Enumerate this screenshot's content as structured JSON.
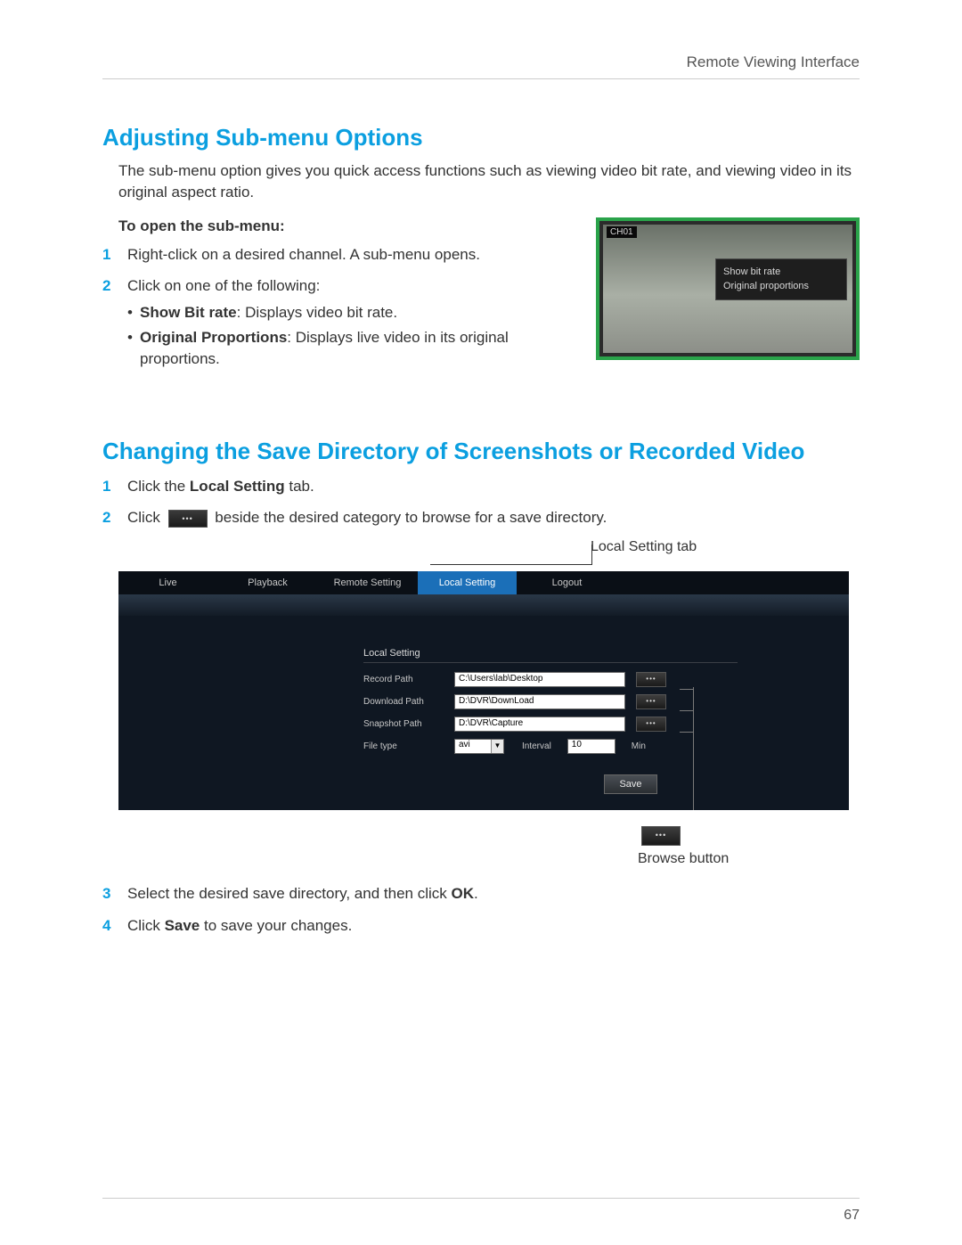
{
  "header": {
    "right": "Remote Viewing Interface"
  },
  "section1": {
    "title": "Adjusting Sub-menu Options",
    "intro": "The sub-menu option gives you quick access functions such as viewing video bit rate, and viewing video in its original aspect ratio.",
    "sub": "To open the sub-menu:",
    "steps": {
      "s1": "Right-click on a desired channel. A sub-menu opens.",
      "s2": "Click on one of the following:",
      "b1_bold": "Show Bit rate",
      "b1_rest": ": Displays video bit rate.",
      "b2_bold": "Original Proportions",
      "b2_rest": ": Displays live video in its original proportions."
    },
    "submenu_shot": {
      "ch": "CH01",
      "item1": "Show bit rate",
      "item2": "Original proportions"
    }
  },
  "section2": {
    "title": "Changing the Save Directory of Screenshots or Recorded Video",
    "s1_pre": "Click the ",
    "s1_bold": "Local Setting",
    "s1_post": " tab.",
    "s2_pre": "Click ",
    "s2_post": " beside the desired category to browse for a save directory.",
    "callout_top": "Local Setting tab",
    "tabs": {
      "live": "Live",
      "playback": "Playback",
      "remote": "Remote Setting",
      "local": "Local Setting",
      "logout": "Logout"
    },
    "panel": {
      "title": "Local Setting",
      "row1_label": "Record Path",
      "row1_value": "C:\\Users\\lab\\Desktop",
      "row2_label": "Download Path",
      "row2_value": "D:\\DVR\\DownLoad",
      "row3_label": "Snapshot Path",
      "row3_value": "D:\\DVR\\Capture",
      "row4_label": "File type",
      "row4_select": "avi",
      "row4_interval": "Interval",
      "row4_num": "10",
      "row4_min": "Min",
      "save": "Save"
    },
    "browse_dots": "•••",
    "callout_bottom": "Browse button",
    "s3_pre": "Select the desired save directory, and then click ",
    "s3_bold": "OK",
    "s3_post": ".",
    "s4_pre": "Click ",
    "s4_bold": "Save",
    "s4_post": " to save your changes."
  },
  "page_number": "67"
}
